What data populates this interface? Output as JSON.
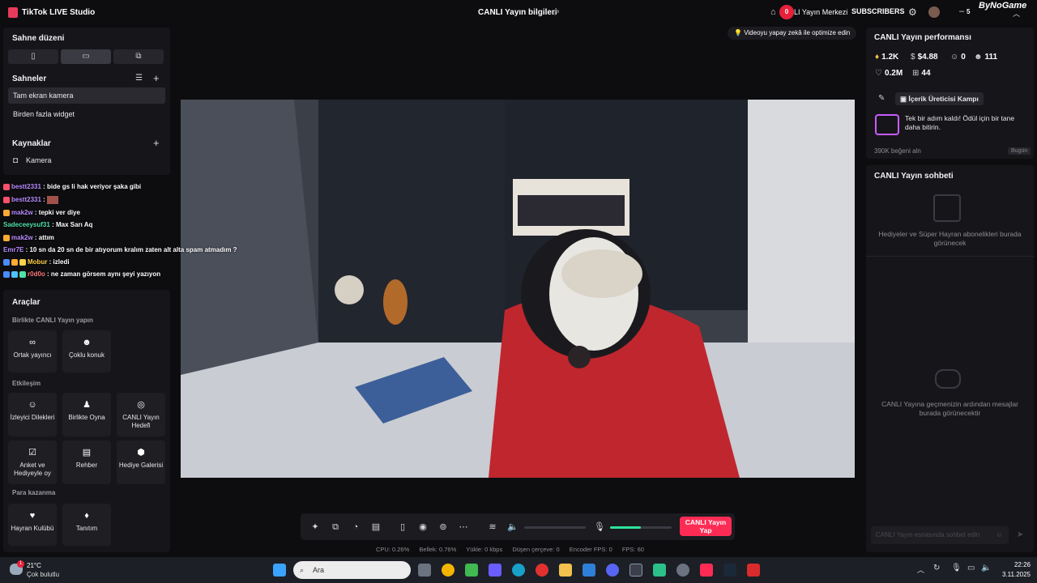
{
  "window": {
    "app_title": "TikTok LIVE Studio",
    "center_title": "CANLI Yayın bilgileri"
  },
  "topbar": {
    "notif_count": "0",
    "center_btn": "LI Yayın Merkezi",
    "subscribers_label": "SUBSCRIBERS",
    "watermark": "ByNoGame",
    "minimize": "–",
    "five": "5"
  },
  "left": {
    "stage_layout_title": "Sahne düzeni",
    "scenes_title": "Sahneler",
    "scenes": [
      "Tam ekran kamera",
      "Birden fazla widget"
    ],
    "sources_title": "Kaynaklar",
    "sources": [
      "Kamera"
    ],
    "tools_title": "Araçlar",
    "collab_label": "Birlikte CANLI Yayın yapın",
    "collab_tools": [
      "Ortak yayıncı",
      "Çoklu konuk"
    ],
    "interaction_label": "Etkileşim",
    "interaction_tools": [
      "İzleyici Dilekleri",
      "Birlikte Oyna",
      "CANLI Yayın Hedefi",
      "Anket ve Hediyeyle oy",
      "Rehber",
      "Hediye Galerisi"
    ],
    "earn_label": "Para kazanma",
    "earn_tools": [
      "Hayran Kulübü",
      "Tanıtım"
    ]
  },
  "chat_overlay": [
    {
      "user": "bestt2331",
      "text": ": bide gs li hak veriyor şaka gibi"
    },
    {
      "user": "bestt2331",
      "text": ":"
    },
    {
      "user": "mak2w",
      "text": ": tepki ver diye"
    },
    {
      "user": "Sadeceeysuf31",
      "text": ": Max Sarı Aq"
    },
    {
      "user": "mak2w",
      "text": ": attım"
    },
    {
      "user": "Emr7E",
      "text": ": 10 sn da 20 sn de bir atıyorum kralım zaten alt alta spam atmadım ?"
    },
    {
      "user": "Mobur",
      "text": ": izledi"
    },
    {
      "user": "r0d0o",
      "text": ": ne zaman görsem aynı şeyi yazıyon"
    }
  ],
  "video": {
    "suggestion": "Videoyu yapay zekâ ile optimize edin"
  },
  "right": {
    "performance_title": "CANLI Yayın performansı",
    "stats": {
      "diamonds": "1.2K",
      "earnings": "$4.88",
      "viewers": "0",
      "followers": "111",
      "likes": "0.2M",
      "gifts": "44"
    },
    "campaign_title": "İçerik Üreticisi Kampı",
    "campaign_text": "Tek bir adım kaldı! Ödül için bir tane daha bitirin.",
    "likes_goal": "390K beğeni aln",
    "today": "Bugün",
    "chat_title": "CANLI Yayın sohbeti",
    "gifts_empty": "Hediyeler ve Süper Hayran abonelikleri burada görünecek",
    "chat_empty": "CANLI Yayına geçmenizin ardından mesajlar burada görünecektir",
    "chat_input_placeholder": "CANLI Yayın esnasında sohbet edin"
  },
  "toolbar": {
    "go_live": "CANLI Yayın Yap",
    "volume_level": 0.0,
    "mic_level": 0.5
  },
  "stats": {
    "cpu": "CPU: 0.26%",
    "memory": "Bellek: 0.76%",
    "upload": "Yükle: 0 kbps",
    "dropped": "Düşen çerçeve: 0",
    "encoder_fps": "Encoder FPS: 0",
    "fps": "FPS: 60"
  },
  "taskbar": {
    "temp": "21°C",
    "weather": "Çok bulutlu",
    "weather_badge": "1",
    "search_placeholder": "Ara",
    "time": "22:26",
    "date": "3.11.2025"
  },
  "colors": {
    "accent": "#fe2c55",
    "panel": "#16161a",
    "bg": "#0d0d10",
    "mic": "#2de39a"
  }
}
